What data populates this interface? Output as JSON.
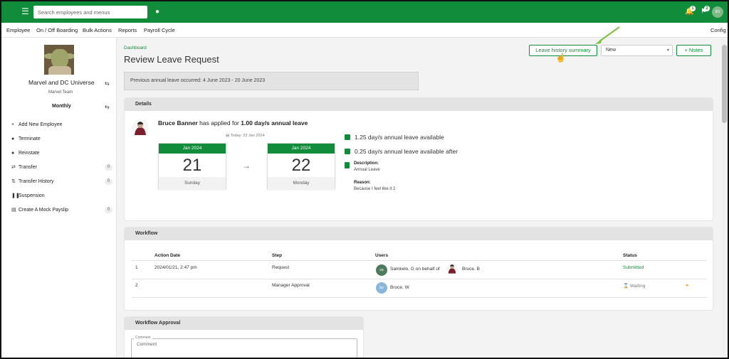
{
  "topbar": {
    "search_placeholder": "Search employees and menus",
    "notifications_count": "1",
    "flag_count": "2",
    "user_initials": "im"
  },
  "menu": {
    "items": [
      "Employee",
      "On / Off Boarding",
      "Bulk Actions",
      "Reports",
      "Payroll Cycle"
    ],
    "config": "Config"
  },
  "sidebar": {
    "company": "Marvel and DC Universe",
    "team": "Marvel Team",
    "period": "Monthly",
    "actions": [
      {
        "label": "Add New Employee",
        "icon": "add-person-icon",
        "count": ""
      },
      {
        "label": "Terminate",
        "icon": "terminate-icon",
        "count": ""
      },
      {
        "label": "Reinstate",
        "icon": "reinstate-icon",
        "count": ""
      },
      {
        "label": "Transfer",
        "icon": "transfer-icon",
        "count": "0"
      },
      {
        "label": "Transfer History",
        "icon": "transfer-history-icon",
        "count": "0"
      },
      {
        "label": "Suspension",
        "icon": "suspension-icon",
        "count": ""
      },
      {
        "label": "Create A Mock Payslip",
        "icon": "payslip-icon",
        "count": "0"
      }
    ]
  },
  "header": {
    "breadcrumb": "Dashboard",
    "title": "Review Leave Request",
    "leave_history_button": "Leave history summary",
    "status_select": "New",
    "notes_button": "+ Notes"
  },
  "notice": "Previous annual leave occurred: 4 June 2023 - 20 June 2023",
  "details": {
    "heading": "Details",
    "employee": "Bruce Banner",
    "applied_text": "has applied for",
    "amount": "1.00 day/s annual leave",
    "today": "Today: 22 Jan 2024",
    "start": {
      "month": "Jan 2024",
      "day": "21",
      "weekday": "Sunday"
    },
    "end": {
      "month": "Jan 2024",
      "day": "22",
      "weekday": "Monday"
    },
    "available": "1.25 day/s annual leave available",
    "available_after": "0.25 day/s annual leave available after",
    "description_label": "Description:",
    "description": "Annual Leave",
    "reason_label": "Reason:",
    "reason": "Because I feel like it 2"
  },
  "workflow": {
    "heading": "Workflow",
    "columns": [
      "Action Date",
      "Step",
      "Users",
      "Status"
    ],
    "rows": [
      {
        "num": "1",
        "date": "2024/01/21, 2:47 pm",
        "step": "Request",
        "user_initials": "sa",
        "user": "Samkelo. G on behalf of",
        "behalf": "Bruce. B",
        "status": "Submitted"
      },
      {
        "num": "2",
        "date": "",
        "step": "Manager Approval",
        "user_initials": "bu",
        "user": "Bruce. W",
        "behalf": "",
        "status": "Waiting"
      }
    ]
  },
  "approval": {
    "heading": "Workflow Approval",
    "comment_label": "Comment",
    "comment_placeholder": "Comment"
  },
  "colors": {
    "brand": "#118c3a",
    "accent_arrow": "#7cc242"
  }
}
